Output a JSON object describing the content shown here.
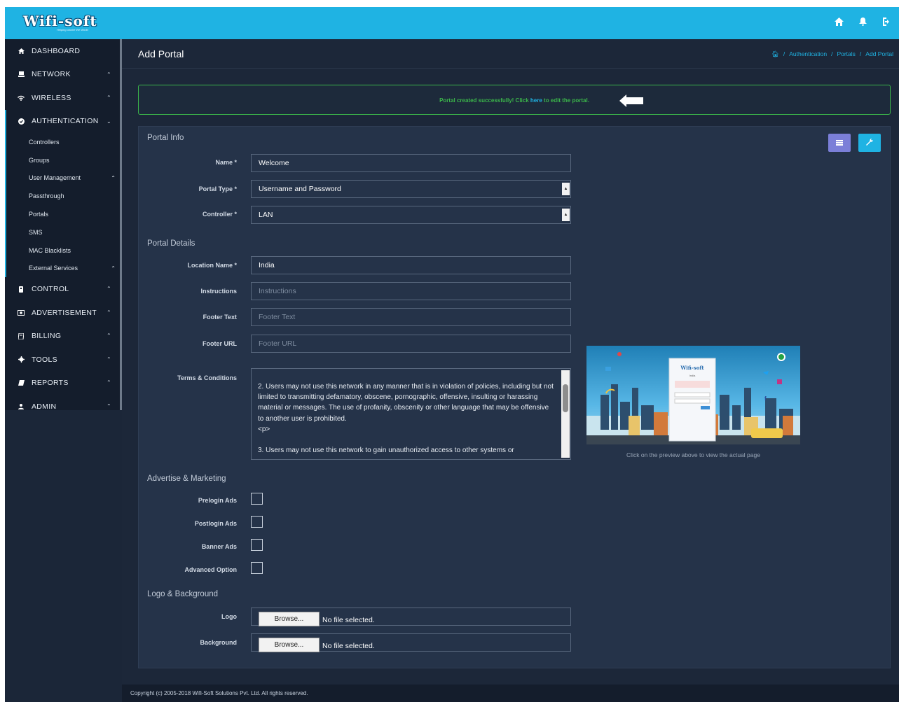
{
  "brand": {
    "name": "Wifi-soft",
    "tagline": "Helping unwire the World"
  },
  "topbar": {
    "icons": [
      "home-icon",
      "bell-icon",
      "logout-icon"
    ]
  },
  "sidebar": {
    "items": [
      {
        "label": "DASHBOARD",
        "icon": "home-icon"
      },
      {
        "label": "NETWORK",
        "icon": "monitor-icon"
      },
      {
        "label": "WIRELESS",
        "icon": "wifi-icon"
      },
      {
        "label": "AUTHENTICATION",
        "icon": "shield-icon"
      },
      {
        "label": "CONTROL",
        "icon": "control-icon"
      },
      {
        "label": "ADVERTISEMENT",
        "icon": "ad-icon"
      },
      {
        "label": "BILLING",
        "icon": "billing-icon"
      },
      {
        "label": "TOOLS",
        "icon": "gear-icon"
      },
      {
        "label": "REPORTS",
        "icon": "report-icon"
      },
      {
        "label": "ADMIN",
        "icon": "user-icon"
      }
    ],
    "auth_sub": [
      "Controllers",
      "Groups",
      "User Management",
      "Passthrough",
      "Portals",
      "SMS",
      "MAC Blacklists",
      "External Services"
    ]
  },
  "page": {
    "title": "Add Portal",
    "breadcrumb": [
      "Authentication",
      "Portals",
      "Add Portal"
    ]
  },
  "alert": {
    "pre": "Portal created successfully! Click ",
    "link": "here",
    "post": " to edit the portal."
  },
  "portal_info": {
    "section": "Portal Info",
    "name_label": "Name *",
    "name_value": "Welcome",
    "type_label": "Portal Type *",
    "type_value": "Username and Password",
    "controller_label": "Controller *",
    "controller_value": "LAN"
  },
  "portal_details": {
    "section": "Portal Details",
    "location_label": "Location Name *",
    "location_value": "India",
    "instructions_label": "Instructions",
    "instructions_placeholder": "Instructions",
    "footer_text_label": "Footer Text",
    "footer_text_placeholder": "Footer Text",
    "footer_url_label": "Footer URL",
    "footer_url_placeholder": "Footer URL",
    "terms_label": "Terms & Conditions",
    "terms_text": "2. Users may not use this network in any manner that is in violation of policies, including but not limited to transmitting defamatory, obscene, pornographic, offensive, insulting or harassing material or messages. The use of profanity, obscenity or other language that may be offensive to another user is prohibited.\n<p>\n\n3. Users may not use this network to gain unauthorized access to other systems or",
    "preview_caption": "Click on the preview above to view the actual page"
  },
  "advertise": {
    "section": "Advertise & Marketing",
    "prelogin": "Prelogin Ads",
    "postlogin": "Postlogin Ads",
    "banner": "Banner Ads",
    "advanced": "Advanced Option"
  },
  "logo_bg": {
    "section": "Logo & Background",
    "logo_label": "Logo",
    "background_label": "Background",
    "browse": "Browse...",
    "no_file": "No file selected."
  },
  "footer": {
    "text": "Copyright (c) 2005-2018 Wifi-Soft Solutions Pvt. Ltd. All rights reserved."
  },
  "colors": {
    "accent": "#1fb3e3",
    "success": "#3bb54a",
    "panel": "#253349",
    "list_button": "#7b7fd8"
  }
}
